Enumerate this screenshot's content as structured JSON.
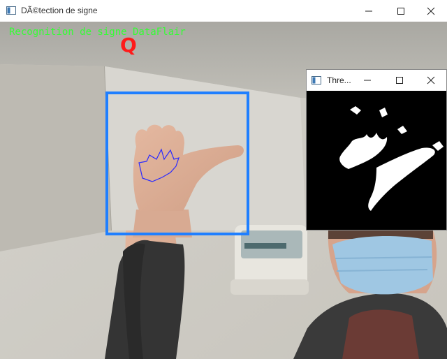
{
  "window": {
    "title": "DÃ©tection de signe",
    "controls": [
      "minimize",
      "maximize",
      "close"
    ]
  },
  "overlay": {
    "header_text": "Recognition de signe DataFlair",
    "predicted_letter": "Q"
  },
  "threshold_window": {
    "title": "Thre...",
    "controls": [
      "minimize",
      "maximize",
      "close"
    ]
  },
  "colors": {
    "overlay_text": "#33ff33",
    "predicted_letter": "#ff1a1a",
    "roi_box": "#1f7fff",
    "contour": "#2a2aff"
  }
}
